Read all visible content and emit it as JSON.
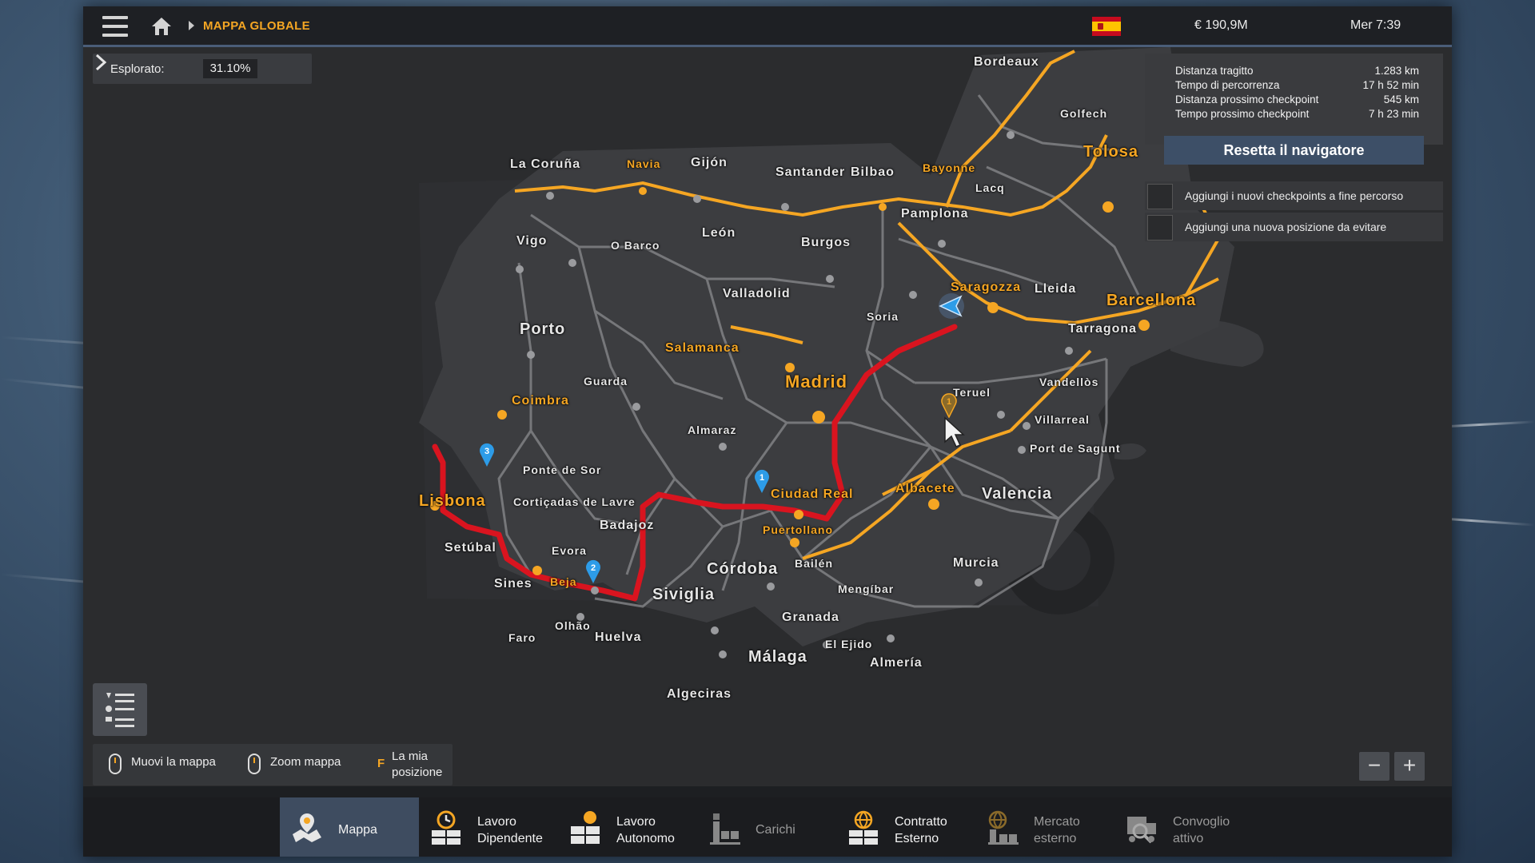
{
  "topbar": {
    "breadcrumb": "MAPPA GLOBALE",
    "money": "€ 190,9M",
    "time": "Mer 7:39"
  },
  "explored": {
    "label": "Esplorato:",
    "value": "31.10%"
  },
  "route_info": {
    "rows": [
      {
        "label": "Distanza tragitto",
        "value": "1.283 km"
      },
      {
        "label": "Tempo di percorrenza",
        "value": "17 h 52 min"
      },
      {
        "label": "Distanza prossimo checkpoint",
        "value": "545 km"
      },
      {
        "label": "Tempo prossimo checkpoint",
        "value": "7 h 23 min"
      }
    ],
    "reset_label": "Resetta il navigatore",
    "options": [
      "Aggiungi i nuovi checkpoints a fine percorso",
      "Aggiungi una nuova posizione da evitare"
    ]
  },
  "cities": [
    {
      "name": "Bordeaux",
      "style": "w"
    },
    {
      "name": "Golfech",
      "style": "w"
    },
    {
      "name": "Tolosa",
      "style": "y"
    },
    {
      "name": "Bayonne",
      "style": "y"
    },
    {
      "name": "Lacq",
      "style": "w"
    },
    {
      "name": "La Coruña",
      "style": "w"
    },
    {
      "name": "Navia",
      "style": "y"
    },
    {
      "name": "Gijón",
      "style": "w"
    },
    {
      "name": "Santander",
      "style": "w"
    },
    {
      "name": "Bilbao",
      "style": "w"
    },
    {
      "name": "Pamplona",
      "style": "w"
    },
    {
      "name": "Vigo",
      "style": "w"
    },
    {
      "name": "O Barco",
      "style": "w"
    },
    {
      "name": "León",
      "style": "w"
    },
    {
      "name": "Burgos",
      "style": "w"
    },
    {
      "name": "Saragozza",
      "style": "y"
    },
    {
      "name": "Lleida",
      "style": "w"
    },
    {
      "name": "Barcellona",
      "style": "y"
    },
    {
      "name": "Valladolid",
      "style": "w"
    },
    {
      "name": "Soria",
      "style": "w"
    },
    {
      "name": "Tarragona",
      "style": "w"
    },
    {
      "name": "Porto",
      "style": "w"
    },
    {
      "name": "Salamanca",
      "style": "y"
    },
    {
      "name": "Guarda",
      "style": "w"
    },
    {
      "name": "Madrid",
      "style": "y"
    },
    {
      "name": "Vandellòs",
      "style": "w"
    },
    {
      "name": "Teruel",
      "style": "w"
    },
    {
      "name": "Coimbra",
      "style": "y"
    },
    {
      "name": "Almaraz",
      "style": "w"
    },
    {
      "name": "Villarreal",
      "style": "w"
    },
    {
      "name": "Port de Sagunt",
      "style": "w"
    },
    {
      "name": "Ponte de Sor",
      "style": "w"
    },
    {
      "name": "Lisbona",
      "style": "y"
    },
    {
      "name": "Cortiçadas de Lavre",
      "style": "w"
    },
    {
      "name": "Ciudad Real",
      "style": "y"
    },
    {
      "name": "Albacete",
      "style": "y"
    },
    {
      "name": "Valencia",
      "style": "w"
    },
    {
      "name": "Badajoz",
      "style": "w"
    },
    {
      "name": "Puertollano",
      "style": "y"
    },
    {
      "name": "Setúbal",
      "style": "w"
    },
    {
      "name": "Evora",
      "style": "w"
    },
    {
      "name": "Bailén",
      "style": "w"
    },
    {
      "name": "Córdoba",
      "style": "w"
    },
    {
      "name": "Murcia",
      "style": "w"
    },
    {
      "name": "Sines",
      "style": "w"
    },
    {
      "name": "Beja",
      "style": "y"
    },
    {
      "name": "Mengíbar",
      "style": "w"
    },
    {
      "name": "Siviglia",
      "style": "w"
    },
    {
      "name": "Granada",
      "style": "w"
    },
    {
      "name": "Olhão",
      "style": "w"
    },
    {
      "name": "Faro",
      "style": "w"
    },
    {
      "name": "Huelva",
      "style": "w"
    },
    {
      "name": "El Ejido",
      "style": "w"
    },
    {
      "name": "Málaga",
      "style": "w"
    },
    {
      "name": "Almería",
      "style": "w"
    },
    {
      "name": "Algeciras",
      "style": "w"
    }
  ],
  "checkpoints": [
    "1",
    "2",
    "3"
  ],
  "avoid_marker": "1",
  "hints": {
    "move": "Muovi la mappa",
    "zoom": "Zoom mappa",
    "key": "F",
    "position_line1": "La mia",
    "position_line2": "posizione"
  },
  "zoom": {
    "minus": "−",
    "plus": "+"
  },
  "tabs": [
    {
      "line1": "Mappa",
      "line2": "",
      "active": true,
      "icon": "map-icon"
    },
    {
      "line1": "Lavoro",
      "line2": "Dipendente",
      "active": false,
      "icon": "clock-cargo-icon"
    },
    {
      "line1": "Lavoro",
      "line2": "Autonomo",
      "active": false,
      "icon": "coin-cargo-icon"
    },
    {
      "line1": "Carichi",
      "line2": "",
      "active": false,
      "icon": "crane-cargo-icon"
    },
    {
      "line1": "Contratto",
      "line2": "Esterno",
      "active": false,
      "icon": "globe-cargo-icon"
    },
    {
      "line1": "Mercato",
      "line2": "esterno",
      "active": false,
      "icon": "globe-crane-icon"
    },
    {
      "line1": "Convoglio",
      "line2": "attivo",
      "active": false,
      "icon": "convoy-icon"
    }
  ],
  "colors": {
    "accent": "#f5a623",
    "route": "#d9141f",
    "active_tab": "#3e4c60",
    "checkpoint": "#2d9ce8"
  }
}
